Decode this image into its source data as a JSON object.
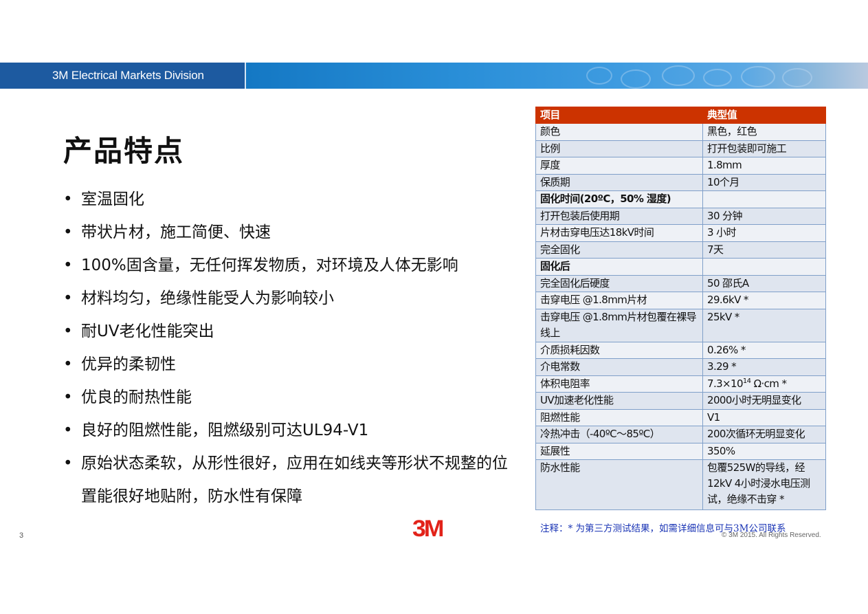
{
  "header": {
    "division": "3M Electrical Markets Division"
  },
  "title": "产品特点",
  "features": [
    "室温固化",
    "带状片材，施工简便、快速",
    "100%固含量，无任何挥发物质，对环境及人体无影响",
    "材料均匀，绝缘性能受人为影响较小",
    "耐UV老化性能突出",
    "优异的柔韧性",
    "优良的耐热性能",
    "良好的阻燃性能，阻燃级别可达UL94-V1",
    "原始状态柔软，从形性很好，应用在如线夹等形状不规整的位置能很好地贴附，防水性有保障"
  ],
  "table": {
    "headers": [
      "项目",
      "典型值"
    ],
    "rows": [
      {
        "item": "颜色",
        "value": "黑色，红色"
      },
      {
        "item": "比例",
        "value": "打开包装即可施工"
      },
      {
        "item": "厚度",
        "value": "1.8mm"
      },
      {
        "item": "保质期",
        "value": "10个月"
      },
      {
        "item": "固化时间(20ºC，50% 湿度)",
        "value": "",
        "section": true
      },
      {
        "item": "打开包装后使用期",
        "value": "30 分钟"
      },
      {
        "item": "片材击穿电压达18kV时间",
        "value": "3 小时"
      },
      {
        "item": "完全固化",
        "value": "7天"
      },
      {
        "item": "固化后",
        "value": "",
        "section": true
      },
      {
        "item": "完全固化后硬度",
        "value": "50 邵氏A"
      },
      {
        "item": "击穿电压 @1.8mm片材",
        "value": "29.6kV *"
      },
      {
        "item": "击穿电压 @1.8mm片材包覆在裸导线上",
        "value": "25kV *"
      },
      {
        "item": "介质损耗因数",
        "value": "0.26% *"
      },
      {
        "item": "介电常数",
        "value": "3.29 *"
      },
      {
        "item": "体积电阻率",
        "value_base": "7.3×10",
        "value_exp": "14",
        "value_unit": " Ω·cm *"
      },
      {
        "item": "UV加速老化性能",
        "value": "2000小时无明显变化"
      },
      {
        "item": "阻燃性能",
        "value": "V1"
      },
      {
        "item": "冷热冲击（-40ºC～85ºC）",
        "value": "200次循环无明显变化"
      },
      {
        "item": "延展性",
        "value": "350%"
      },
      {
        "item": "防水性能",
        "value": "包覆525W的导线，经12kV 4小时浸水电压测试，绝缘不击穿 *"
      }
    ]
  },
  "note": "注释：* 为第三方测试结果，如需详细信息可与3M公司联系",
  "copyright": "© 3M 2015. All Rights Reserved.",
  "page_number": "3",
  "logo_text": "3M",
  "colors": {
    "header_blue": "#1d5aa0",
    "table_header_red": "#cc3300",
    "logo_red": "#e2231a",
    "note_blue": "#1a34b5"
  }
}
